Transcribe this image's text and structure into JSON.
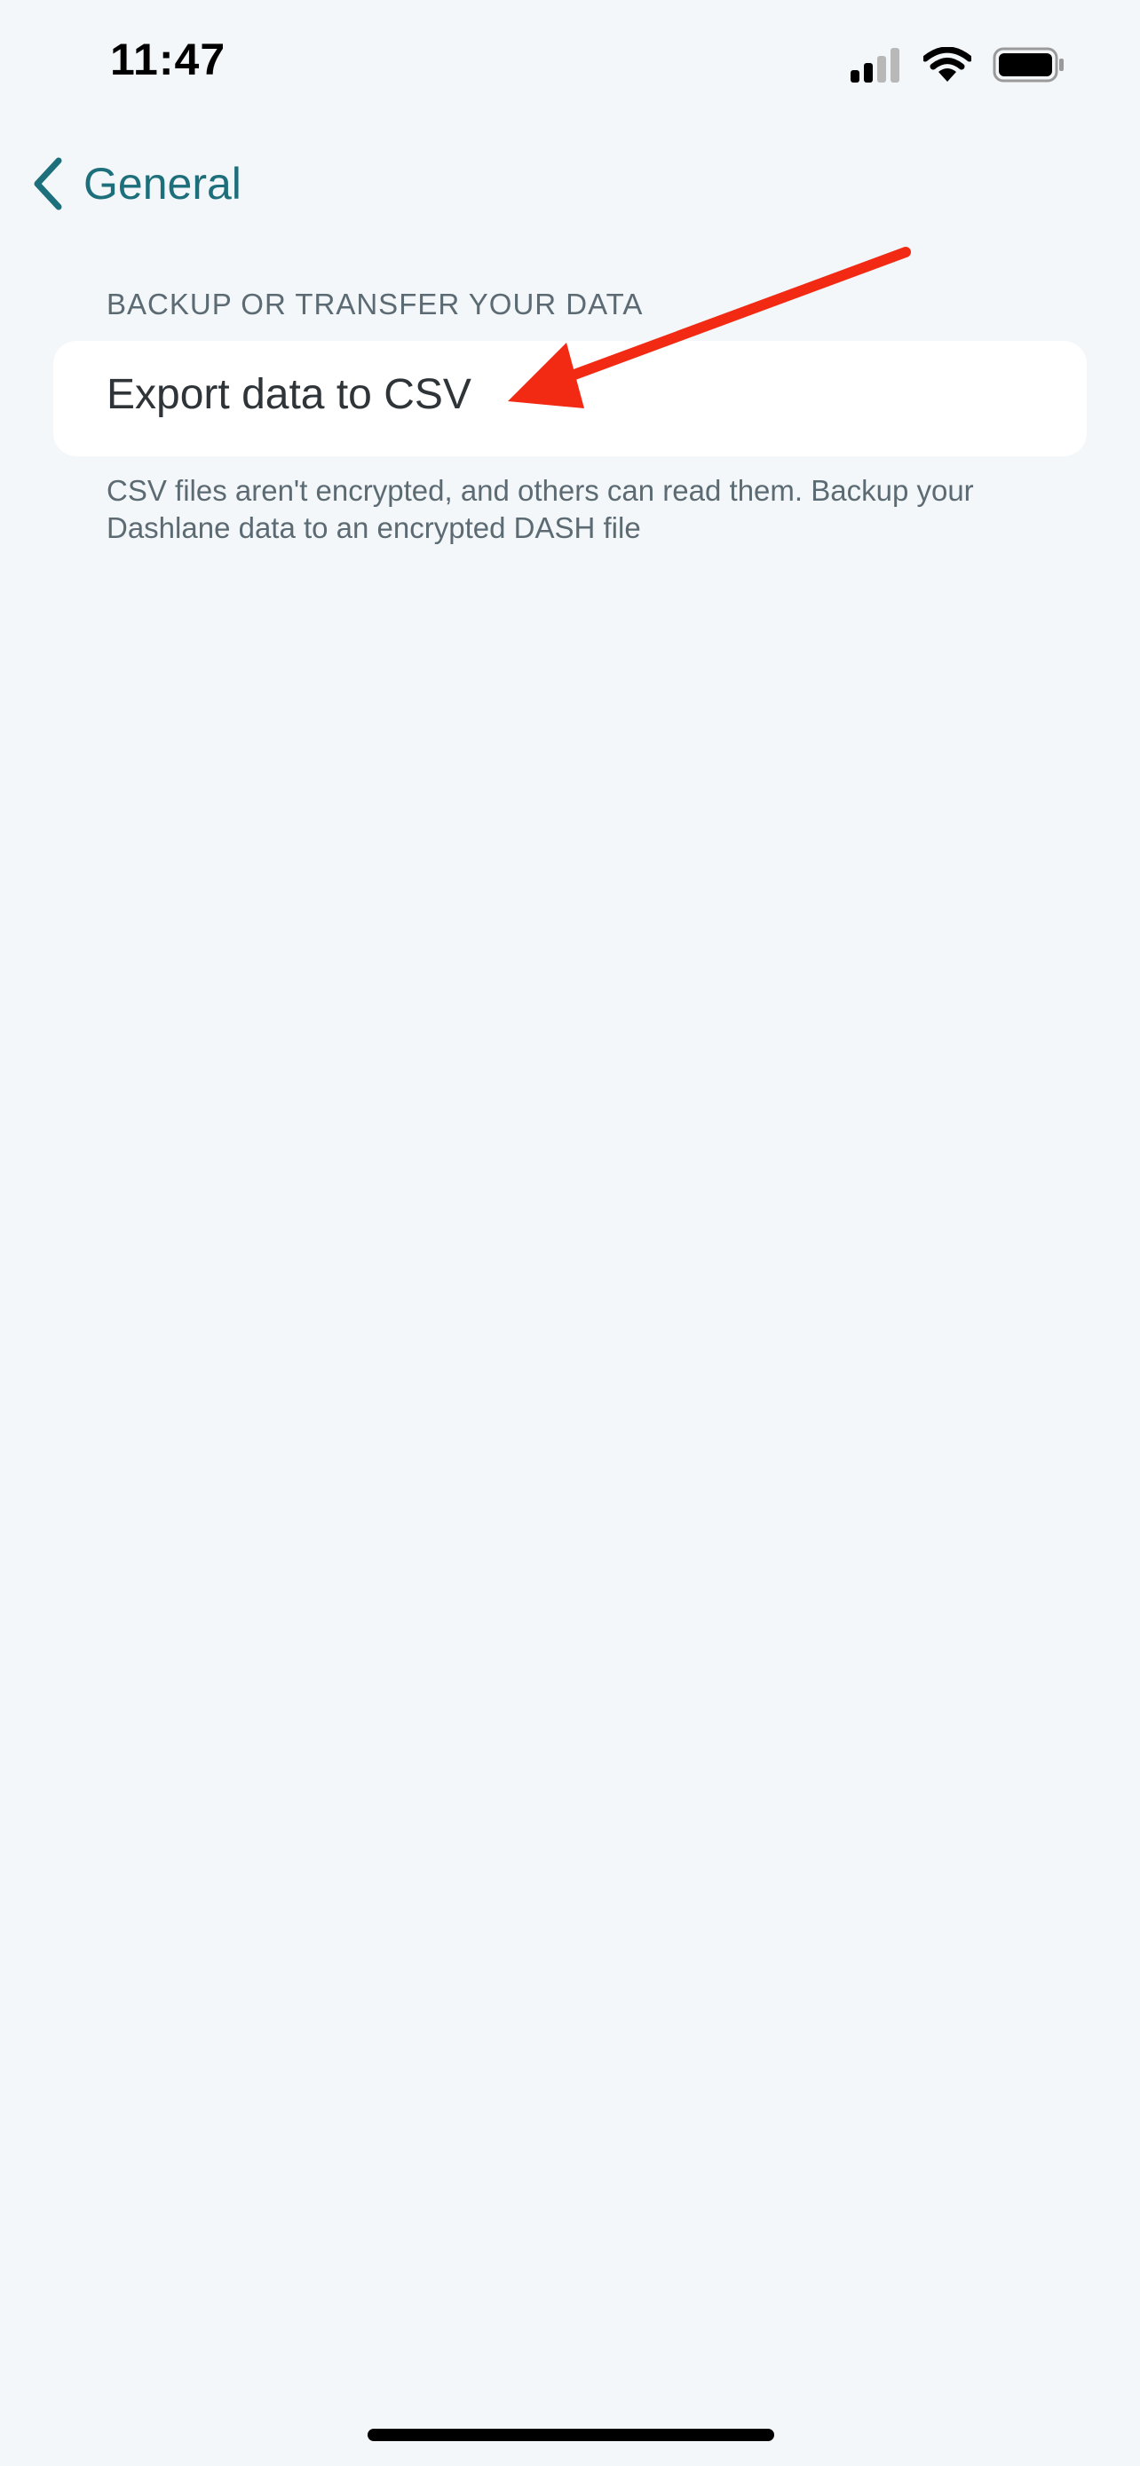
{
  "status_bar": {
    "time": "11:47",
    "icons": [
      "signal-icon",
      "wifi-icon",
      "battery-icon"
    ]
  },
  "nav": {
    "back_label": "General",
    "back_icon": "chevron-left-icon"
  },
  "section": {
    "header": "BACKUP OR TRANSFER YOUR DATA",
    "items": [
      {
        "label": "Export data to CSV"
      }
    ],
    "footer": "CSV files aren't encrypted, and others can read them. Backup your Dashlane data to an encrypted DASH file"
  },
  "annotation": {
    "arrow_color": "#f22a14",
    "icon": "red-arrow-annotation"
  },
  "colors": {
    "accent": "#1d6f7b",
    "background": "#f3f7f9",
    "card": "#ffffff",
    "secondary_text": "#5c6b73"
  }
}
